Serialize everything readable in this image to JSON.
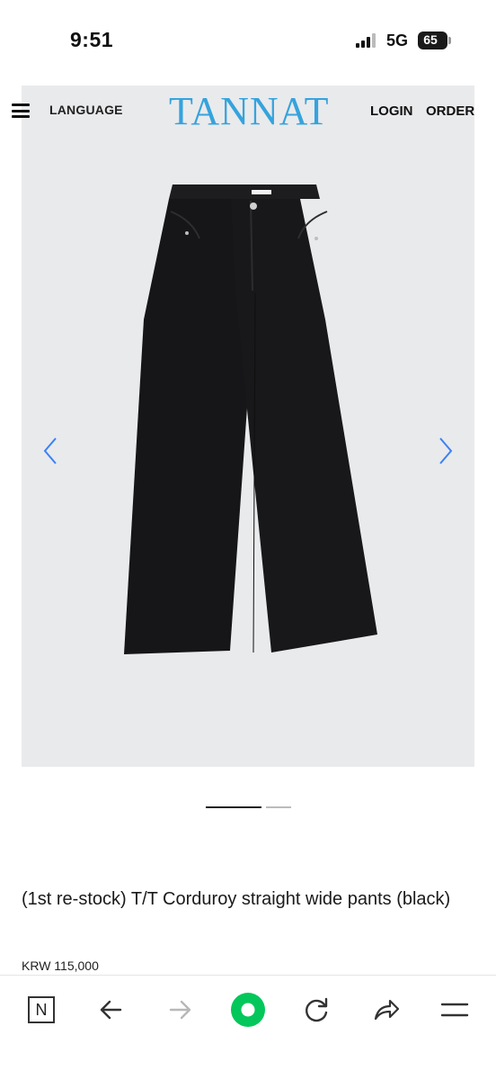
{
  "status_bar": {
    "time": "9:51",
    "network": "5G",
    "battery": "65"
  },
  "header": {
    "language_label": "LANGUAGE",
    "brand": "TANNAT",
    "login_label": "LOGIN",
    "order_label": "ORDER"
  },
  "colors": {
    "brand": "#35a3dd",
    "hero_bg": "#e9eaec",
    "home_button": "#03c75a",
    "arrow": "#3b82f6"
  },
  "gallery": {
    "current_slide": 1,
    "total_slides": 2
  },
  "product": {
    "title": "(1st re-stock) T/T Corduroy straight wide pants (black)",
    "price": "KRW 115,000"
  },
  "toolbar": {
    "n_label": "N",
    "icons": [
      "n-icon",
      "back-arrow-icon",
      "forward-arrow-icon",
      "home-icon",
      "reload-icon",
      "share-icon",
      "menu-icon"
    ]
  }
}
